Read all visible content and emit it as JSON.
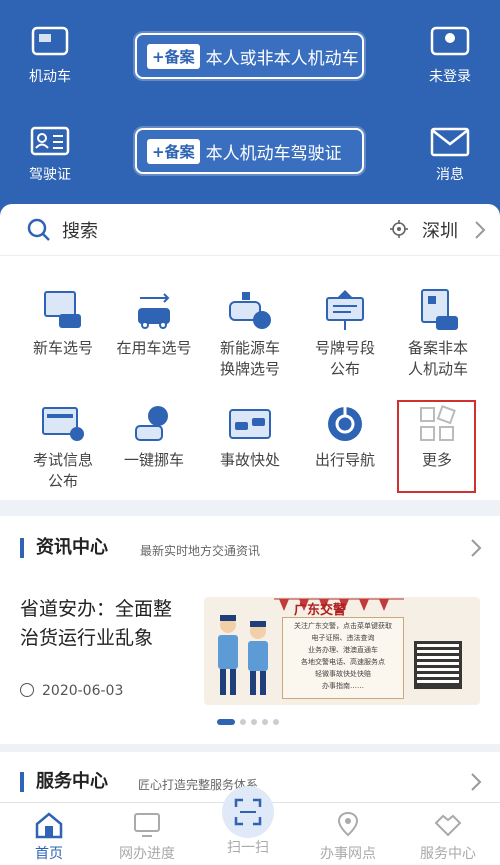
{
  "header": {
    "car_label": "机动车",
    "login_label": "未登录",
    "license_label": "驾驶证",
    "message_label": "消息",
    "pill1_tag": "+备案",
    "pill1_text": "本人或非本人机动车",
    "pill2_tag": "+备案",
    "pill2_text": "本人机动车驾驶证"
  },
  "search": {
    "label": "搜索",
    "city": "深圳"
  },
  "services": [
    {
      "label": "新车选号",
      "icon": "new-car-icon"
    },
    {
      "label": "在用车选号",
      "icon": "used-car-icon"
    },
    {
      "label": "新能源车\n换牌选号",
      "icon": "ev-car-icon"
    },
    {
      "label": "号牌号段\n公布",
      "icon": "plate-sign-icon"
    },
    {
      "label": "备案非本\n人机动车",
      "icon": "register-car-icon"
    },
    {
      "label": "考试信息\n公布",
      "icon": "exam-info-icon"
    },
    {
      "label": "一键挪车",
      "icon": "move-car-icon"
    },
    {
      "label": "事故快处",
      "icon": "accident-icon"
    },
    {
      "label": "出行导航",
      "icon": "navigation-icon"
    },
    {
      "label": "更多",
      "icon": "more-grid-icon"
    }
  ],
  "news": {
    "title": "资讯中心",
    "subtitle": "最新实时地方交通资讯",
    "headline": "省道安办：全面整治货运行业乱象",
    "date": "2020-06-03",
    "banner_title": "广东交警",
    "banner_lines": [
      "关注广东交警，点击菜单键获取",
      "电子证照、违法查询",
      "业务办理、港澳直通车",
      "各地交警电话、高速服务点",
      "轻微事故快处快赔",
      "办事指南……"
    ]
  },
  "service_center": {
    "title": "服务中心",
    "subtitle": "匠心打造完整服务体系"
  },
  "tabbar": [
    {
      "label": "首页",
      "active": true
    },
    {
      "label": "网办进度",
      "active": false
    },
    {
      "label": "扫一扫",
      "active": false
    },
    {
      "label": "办事网点",
      "active": false
    },
    {
      "label": "服务中心",
      "active": false
    }
  ],
  "colors": {
    "brand": "#2f63b3",
    "highlight": "#d03030"
  }
}
